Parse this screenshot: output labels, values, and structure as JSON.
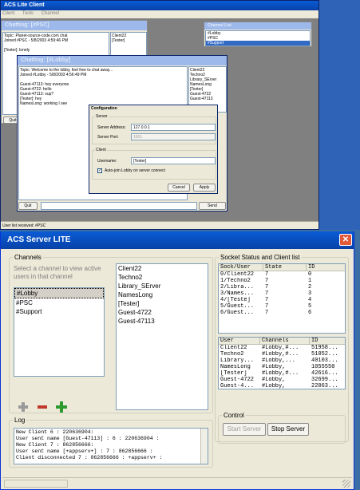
{
  "client": {
    "title": "ACS Lite Client",
    "menu": [
      "Client",
      "Tools",
      "Channel"
    ],
    "status": "User list received: #PSC",
    "psc": {
      "title": "Chatting: [#PSC]",
      "lines": [
        "Topic: Planet-source-code.com chat",
        "Joined #PSC - 5/8/2003 4:59:46 PM",
        "",
        "[Tester]: lonely"
      ],
      "users": [
        "Client22",
        "[Tester]"
      ],
      "quit": "Quit"
    },
    "channel_list": {
      "title": "Channel List",
      "items": [
        "#Lobby",
        "#PSC",
        "#Support"
      ]
    },
    "lobby": {
      "title": "Chatting: [#Lobby]",
      "lines": [
        "Topic: Welcome to the lobby, feel free to chat away...",
        "Joined #Lobby - 5/8/2003 4:56:49 PM",
        "",
        "Guest-47113: hey everyone",
        "Guest-4722: hello",
        "Guest-47113: sup?",
        "[Tester]: hey",
        "NamesLong: working I see"
      ],
      "users": [
        "Client22",
        "Techno2",
        "Library_SErver",
        "NamesLong",
        "[Tester]",
        "Guest-4722",
        "Guest-47113"
      ],
      "quit": "Quit",
      "send": "Send"
    },
    "config": {
      "title": "Configuration",
      "server_group": "Server",
      "address_label": "Server Address:",
      "address_value": "127.0.0.1",
      "port_label": "Server Port:",
      "port_value": "1001",
      "client_group": "Client",
      "username_label": "Username:",
      "username_value": "[Tester]",
      "autojoin_label": "Auto-join Lobby on server connect",
      "cancel": "Cancel",
      "apply": "Apply"
    }
  },
  "server": {
    "title": "ACS Server LITE",
    "channels_group": "Channels",
    "channels_hint": "Select a channel to view active users in that channel",
    "channels": [
      "#Lobby",
      "#PSC",
      "#Support"
    ],
    "channel_users": [
      "Client22",
      "Techno2",
      "Library_SErver",
      "NamesLong",
      "[Tester]",
      "Guest-4722",
      "Guest-47113"
    ],
    "socket_group": "Socket Status and Client list",
    "sock_headers": [
      "Sock/User",
      "State",
      "ID"
    ],
    "sock_rows": [
      [
        "0/Client22",
        "7",
        "0"
      ],
      [
        "1/Techno2",
        "7",
        "1"
      ],
      [
        "2/Libra...",
        "7",
        "2"
      ],
      [
        "3/Names...",
        "7",
        "3"
      ],
      [
        "4/[Teste]",
        "7",
        "4"
      ],
      [
        "5/Guest...",
        "7",
        "5"
      ],
      [
        "6/Guest...",
        "7",
        "6"
      ]
    ],
    "user_headers": [
      "User",
      "Channels",
      "ID"
    ],
    "user_rows": [
      [
        "Client22",
        "#Lobby,#...",
        "51958..."
      ],
      [
        "Techno2",
        "#Lobby,#...",
        "51052..."
      ],
      [
        "Library...",
        "#Lobby,...",
        "40103..."
      ],
      [
        "NamesLong",
        "#Lobby,",
        "1055550"
      ],
      [
        "[Tester]",
        "#Lobby,#...",
        "42616..."
      ],
      [
        "Guest-4722",
        "#Lobby,",
        "32699..."
      ],
      [
        "Guest-4...",
        "#Lobby,",
        "22063..."
      ]
    ],
    "log_group": "Log",
    "log_lines": [
      "New Client 6 : 220636904:",
      "User sent name [Guest-47113] : 6 : 220636904 :",
      "New Client 7 : 862856666:",
      "User sent name [+appserv+] : 7 : 862856666 :",
      "Client disconnected 7 : 862856666 : +appserv+ :"
    ],
    "control_group": "Control",
    "start": "Start Server",
    "stop": "Stop Server"
  }
}
